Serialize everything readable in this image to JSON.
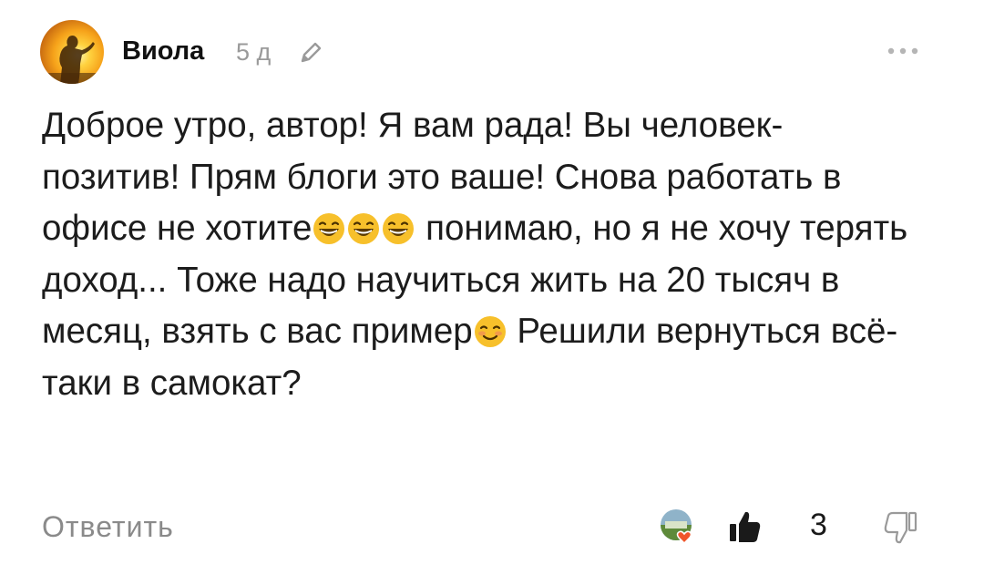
{
  "comment": {
    "author": "Виола",
    "age": "5 д",
    "text_segments": [
      "Доброе утро, автор! Я вам рада! Вы человек-позитив! Прям блоги это ваше! Снова работать в офисе не хотите",
      " понимаю, но я не хочу терять доход... Тоже надо научиться жить на 20 тысяч в месяц, взять с вас пример",
      " Решили вернуться всё-таки в самокат?"
    ],
    "emojis": [
      "grinning-squinting-emoji",
      "smiling-blush-emoji"
    ]
  },
  "actions": {
    "reply_label": "Ответить",
    "like_count": "3"
  },
  "icons": {
    "edit": "pencil-icon",
    "more": "more-icon",
    "like": "thumbs-up-icon",
    "dislike": "thumbs-down-icon"
  },
  "colors": {
    "text": "#1c1c1c",
    "muted": "#9a9a9a",
    "emoji": "#f7c02b"
  }
}
